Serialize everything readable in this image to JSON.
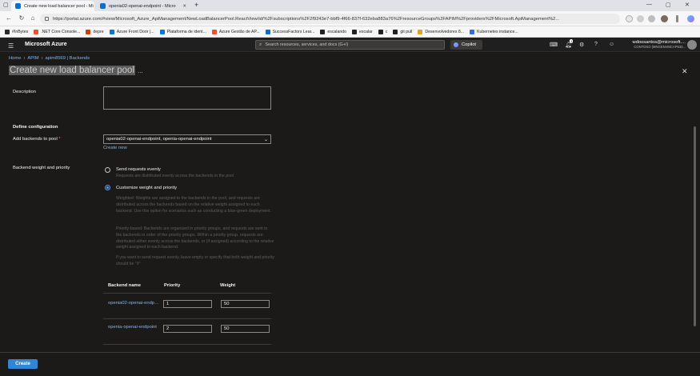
{
  "browser": {
    "tabs": [
      {
        "label": "Create new load balancer pool - Mi"
      },
      {
        "label": "openia02-openai-endpoint - Micro"
      }
    ],
    "new_tab": "+",
    "url": "https://portal.azure.com/#view/Microsoft_Azure_ApiManagement/NewLoadBalancerPool.ReactView/id/%2Fsubscriptions%2F2f9243e7-bbf9-4f66-837f-632eba883a76%2FresourceGroups%2FAPIM%2Fproviders%2FMicrosoft.ApiManagement%2...",
    "bookmarks": [
      {
        "label": "#InBytes",
        "color": "#2b2b2b"
      },
      {
        "label": ".NET Core Console...",
        "color": "#f25022"
      },
      {
        "label": "depre",
        "color": "#d83b01"
      },
      {
        "label": "Azure Front Door |...",
        "color": "#0078d4"
      },
      {
        "label": "Plataforma de ident...",
        "color": "#0078d4"
      },
      {
        "label": "Azure Gestão de AP...",
        "color": "#f25022"
      },
      {
        "label": "SuccessFactors Lear...",
        "color": "#0a6ed1"
      },
      {
        "label": "escalando",
        "color": "#222"
      },
      {
        "label": "escalar",
        "color": "#222"
      },
      {
        "label": "c",
        "color": "#222"
      },
      {
        "label": "git pull",
        "color": "#222"
      },
      {
        "label": "Desenvolvedores 8...",
        "color": "#e3a21a"
      },
      {
        "label": "Kubernetes instance...",
        "color": "#326ce5"
      }
    ]
  },
  "portal": {
    "brand": "Microsoft Azure",
    "search_placeholder": "Search resources, services, and docs (G+/)",
    "copilot": "Copilot",
    "notification_count": "1",
    "account_name": "wdossantos@microsoft....",
    "account_tenant": "CONTOSO (MNGENVMCAP633..."
  },
  "breadcrumb": [
    "Home",
    "APIM",
    "apim8569 | Backends"
  ],
  "page_title": "Create new load balancer pool",
  "more": "...",
  "form": {
    "description_label": "Description",
    "description_value": "",
    "section_title": "Define configuration",
    "add_backends_label": "Add backends to pool",
    "required_marker": "*",
    "backends_selected": "openia02-openai-endpoint, openia-openai-endpoint",
    "create_new": "Create new",
    "weight_label": "Backend weight and priority",
    "option_evenly": "Send requests evenly",
    "option_evenly_desc": "Requests are distributed evenly across the backends in the pool",
    "option_custom": "Customize weight and priority",
    "help_weighted": "Weighted: Weights are assigned to the backends in the pool, and requests are distributed across the backends based on the relative weight assigned to each backend. Use this option for scenarios such as conducting a blue-green deployment.",
    "help_priority": "Priority-based: Backends are organized in priority groups, and requests are sent to the backends in order of the priority groups. Within a priority group, requests are distributed either evenly across the backends, or (if assigned) according to the relative weight assigned to each backend.",
    "help_even": "If you want to send request evenly, leave empty or specify that both weight and priority should be \"0\"",
    "table_headers": [
      "Backend name",
      "Priority",
      "Weight"
    ],
    "rows": [
      {
        "name": "openia02-openai-endpoint",
        "priority": "1",
        "weight": "50"
      },
      {
        "name": "openia-openai-endpoint",
        "priority": "2",
        "weight": "50"
      }
    ]
  },
  "footer": {
    "create": "Create"
  }
}
